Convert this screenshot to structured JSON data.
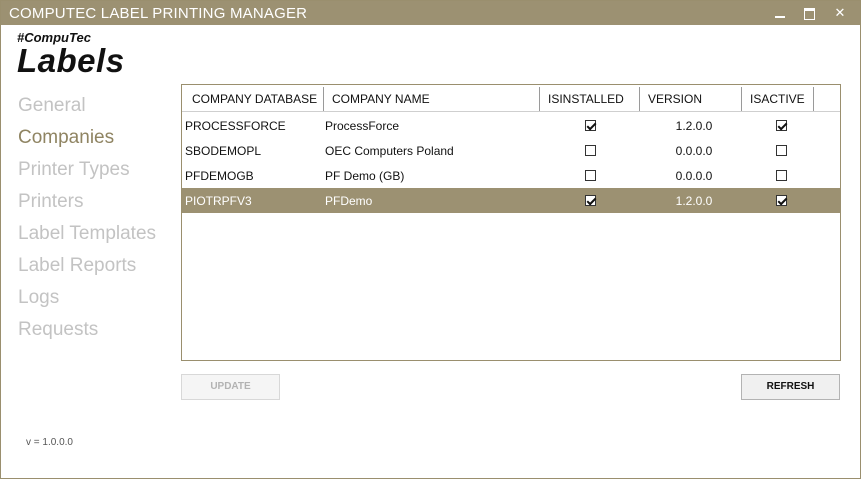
{
  "window": {
    "title": "COMPUTEC LABEL PRINTING MANAGER",
    "minimize_icon": "minimize-icon",
    "maximize_icon": "maximize-icon",
    "close_icon": "close-icon",
    "close_glyph": "✕"
  },
  "logo": {
    "small": "#CompuTec",
    "big": "Labels"
  },
  "nav": {
    "items": [
      {
        "label": "General"
      },
      {
        "label": "Companies",
        "active": true
      },
      {
        "label": "Printer Types"
      },
      {
        "label": "Printers"
      },
      {
        "label": "Label Templates"
      },
      {
        "label": "Label Reports"
      },
      {
        "label": "Logs"
      },
      {
        "label": "Requests"
      }
    ]
  },
  "grid": {
    "columns": [
      "COMPANY DATABASE",
      "COMPANY NAME",
      "ISINSTALLED",
      "VERSION",
      "ISACTIVE"
    ],
    "rows": [
      {
        "database": "PROCESSFORCE",
        "name": "ProcessForce",
        "isinstalled": true,
        "version": "1.2.0.0",
        "isactive": true
      },
      {
        "database": "SBODEMOPL",
        "name": "OEC Computers Poland",
        "isinstalled": false,
        "version": "0.0.0.0",
        "isactive": false
      },
      {
        "database": "PFDEMOGB",
        "name": "PF Demo (GB)",
        "isinstalled": false,
        "version": "0.0.0.0",
        "isactive": false
      },
      {
        "database": "PIOTRPFV3",
        "name": "PFDemo",
        "isinstalled": true,
        "version": "1.2.0.0",
        "isactive": true,
        "selected": true
      }
    ]
  },
  "buttons": {
    "update": "UPDATE",
    "refresh": "REFRESH"
  },
  "footer": {
    "version": "v = 1.0.0.0"
  },
  "colors": {
    "accent": "#9c9172",
    "nav_active": "#8f8462",
    "nav_inactive": "#c3c3c3"
  }
}
